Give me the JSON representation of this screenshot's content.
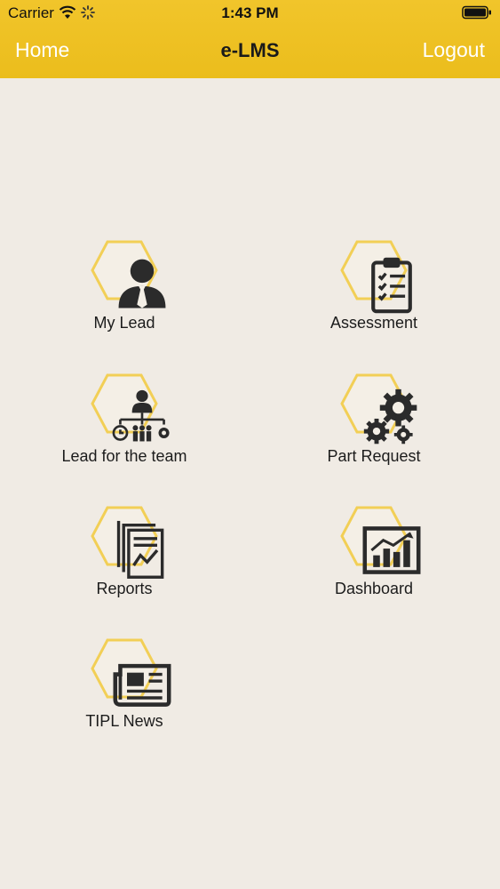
{
  "status": {
    "carrier": "Carrier",
    "time": "1:43 PM"
  },
  "nav": {
    "home": "Home",
    "title": "e-LMS",
    "logout": "Logout"
  },
  "colors": {
    "header": "#f1c52b",
    "background": "#f0ebe4",
    "hex_border": "#f2cf56",
    "icon": "#2b2b2b"
  },
  "menu": [
    {
      "label": "My Lead",
      "icon": "user-tie-icon"
    },
    {
      "label": "Assessment",
      "icon": "clipboard-checklist-icon"
    },
    {
      "label": "Lead for the team",
      "icon": "team-hierarchy-icon"
    },
    {
      "label": "Part Request",
      "icon": "gears-icon"
    },
    {
      "label": "Reports",
      "icon": "report-document-icon"
    },
    {
      "label": "Dashboard",
      "icon": "bar-chart-icon"
    },
    {
      "label": "TIPL News",
      "icon": "newspaper-icon"
    }
  ]
}
